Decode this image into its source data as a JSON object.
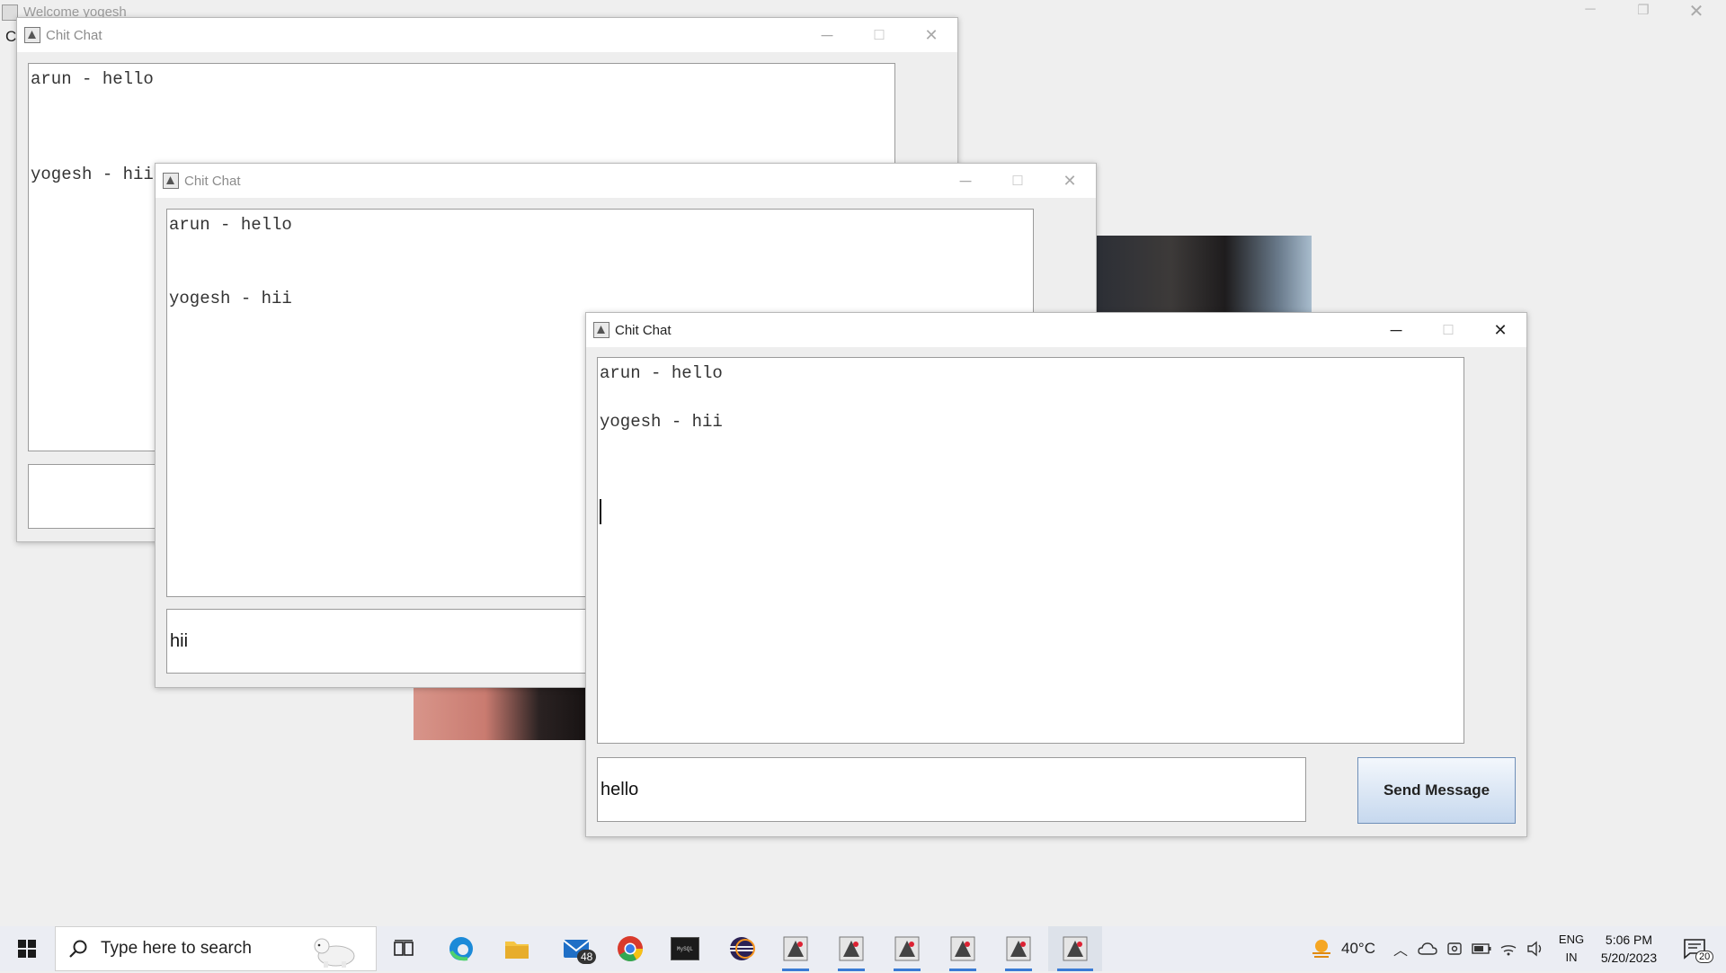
{
  "background_window": {
    "title": "Welcome yogesh",
    "partial_label": "C"
  },
  "windows": [
    {
      "title": "Chit Chat",
      "messages": [
        "arun - hello",
        "yogesh - hii"
      ],
      "input_value": ""
    },
    {
      "title": "Chit Chat",
      "messages": [
        "arun - hello",
        "yogesh - hii"
      ],
      "input_value": "hii"
    },
    {
      "title": "Chit Chat",
      "messages": [
        "arun - hello",
        "yogesh - hii"
      ],
      "input_value": "hello",
      "send_label": "Send Message"
    }
  ],
  "taskbar": {
    "search_placeholder": "Type here to search",
    "mail_badge": "48",
    "weather_temp": "40°C",
    "lang_primary": "ENG",
    "lang_secondary": "IN",
    "time": "5:06 PM",
    "date": "5/20/2023",
    "notification_count": "20",
    "terminal_label": "MySQL",
    "accent_color": "#3a7bd5"
  }
}
